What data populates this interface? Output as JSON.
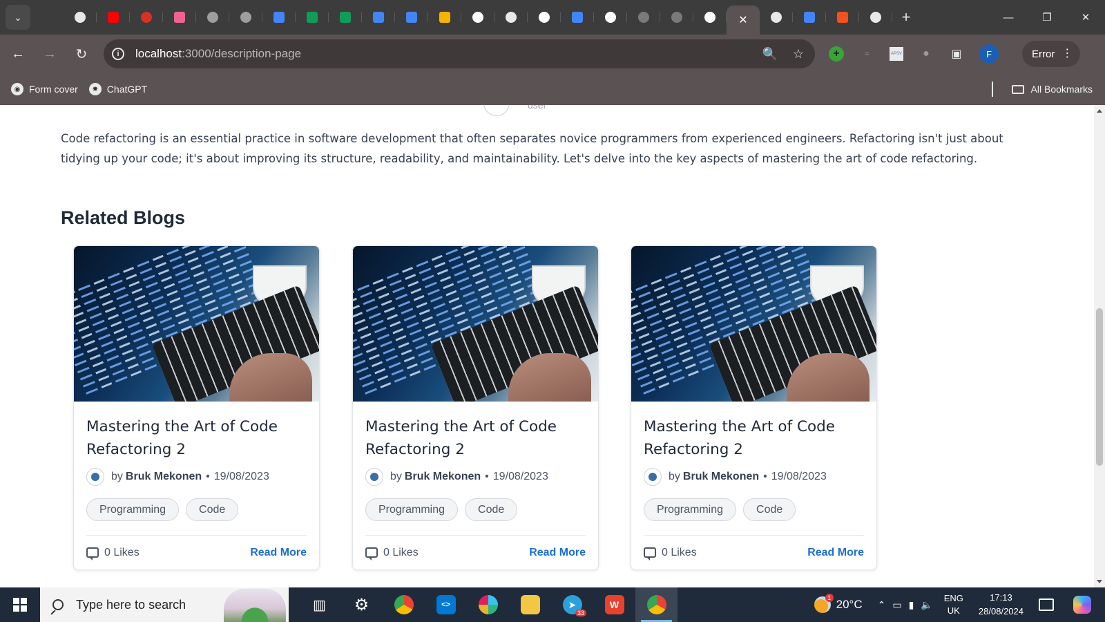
{
  "browser": {
    "tabs": [
      {
        "icon": "chatgpt-icon",
        "color": "#e8e8e8"
      },
      {
        "icon": "youtube-icon",
        "color": "#ff0000"
      },
      {
        "icon": "gauge-icon",
        "color": "#d93025"
      },
      {
        "icon": "extension-icon",
        "color": "#f06292"
      },
      {
        "icon": "globe-icon",
        "color": "#9e9e9e"
      },
      {
        "icon": "globe-icon",
        "color": "#9e9e9e"
      },
      {
        "icon": "docs-icon",
        "color": "#4285f4"
      },
      {
        "icon": "sheets-icon",
        "color": "#0f9d58"
      },
      {
        "icon": "sheets-icon",
        "color": "#0f9d58"
      },
      {
        "icon": "docs-icon",
        "color": "#4285f4"
      },
      {
        "icon": "docs-icon",
        "color": "#4285f4"
      },
      {
        "icon": "chart-icon",
        "color": "#f4b400"
      },
      {
        "icon": "google-icon",
        "color": "#ffffff"
      },
      {
        "icon": "chatgpt-icon",
        "color": "#e8e8e8"
      },
      {
        "icon": "google-icon",
        "color": "#ffffff"
      },
      {
        "icon": "docs-icon",
        "color": "#4285f4"
      },
      {
        "icon": "google-icon",
        "color": "#ffffff"
      },
      {
        "icon": "globe-icon",
        "color": "#7a7a7a"
      },
      {
        "icon": "globe-icon",
        "color": "#7a7a7a"
      },
      {
        "icon": "google-icon",
        "color": "#ffffff"
      },
      {
        "icon": "close-icon",
        "color": "#ffffff",
        "active": true
      },
      {
        "icon": "chatgpt-icon",
        "color": "#e8e8e8"
      },
      {
        "icon": "docs-icon",
        "color": "#4285f4"
      },
      {
        "icon": "app-icon",
        "color": "#f4511e"
      },
      {
        "icon": "chatgpt-icon",
        "color": "#e8e8e8"
      }
    ],
    "url_host": "localhost",
    "url_path": ":3000/description-page",
    "profile_initial": "F",
    "error_label": "Error",
    "bookmarks": [
      {
        "label": "Form cover",
        "icon": "globe-icon"
      },
      {
        "label": "ChatGPT",
        "icon": "chatgpt-icon"
      }
    ],
    "all_bookmarks_label": "All Bookmarks"
  },
  "page": {
    "peek_text": "user",
    "intro": "Code refactoring is an essential practice in software development that often separates novice programmers from experienced engineers. Refactoring isn't just about tidying up your code; it's about improving its structure, readability, and maintainability. Let's delve into the key aspects of mastering the art of code refactoring.",
    "related_heading": "Related Blogs",
    "cards": [
      {
        "title": "Mastering the Art of Code Refactoring 2",
        "by": "by",
        "author": "Bruk Mekonen",
        "date": "19/08/2023",
        "tags": [
          "Programming",
          "Code"
        ],
        "likes": "0 Likes",
        "read_more": "Read More"
      },
      {
        "title": "Mastering the Art of Code Refactoring 2",
        "by": "by",
        "author": "Bruk Mekonen",
        "date": "19/08/2023",
        "tags": [
          "Programming",
          "Code"
        ],
        "likes": "0 Likes",
        "read_more": "Read More"
      },
      {
        "title": "Mastering the Art of Code Refactoring 2",
        "by": "by",
        "author": "Bruk Mekonen",
        "date": "19/08/2023",
        "tags": [
          "Programming",
          "Code"
        ],
        "likes": "0 Likes",
        "read_more": "Read More"
      }
    ]
  },
  "taskbar": {
    "search_placeholder": "Type here to search",
    "apps": [
      {
        "name": "task-view-icon",
        "color": "#1f2b3a"
      },
      {
        "name": "settings-icon",
        "color": "#1f2b3a"
      },
      {
        "name": "chrome-icon",
        "color": "#34a853"
      },
      {
        "name": "vscode-icon",
        "color": "#0078d4"
      },
      {
        "name": "slack-icon",
        "color": "#ffffff"
      },
      {
        "name": "file-explorer-icon",
        "color": "#f2c744"
      },
      {
        "name": "telegram-icon",
        "color": "#2aa1da",
        "badge": "33"
      },
      {
        "name": "wps-icon",
        "color": "#e8422c"
      },
      {
        "name": "chrome-profile-icon",
        "color": "#34a853",
        "active": true
      }
    ],
    "weather_temp": "20°C",
    "weather_badge": "1",
    "lang_1": "ENG",
    "lang_2": "UK",
    "time": "17:13",
    "date": "28/08/2024"
  }
}
